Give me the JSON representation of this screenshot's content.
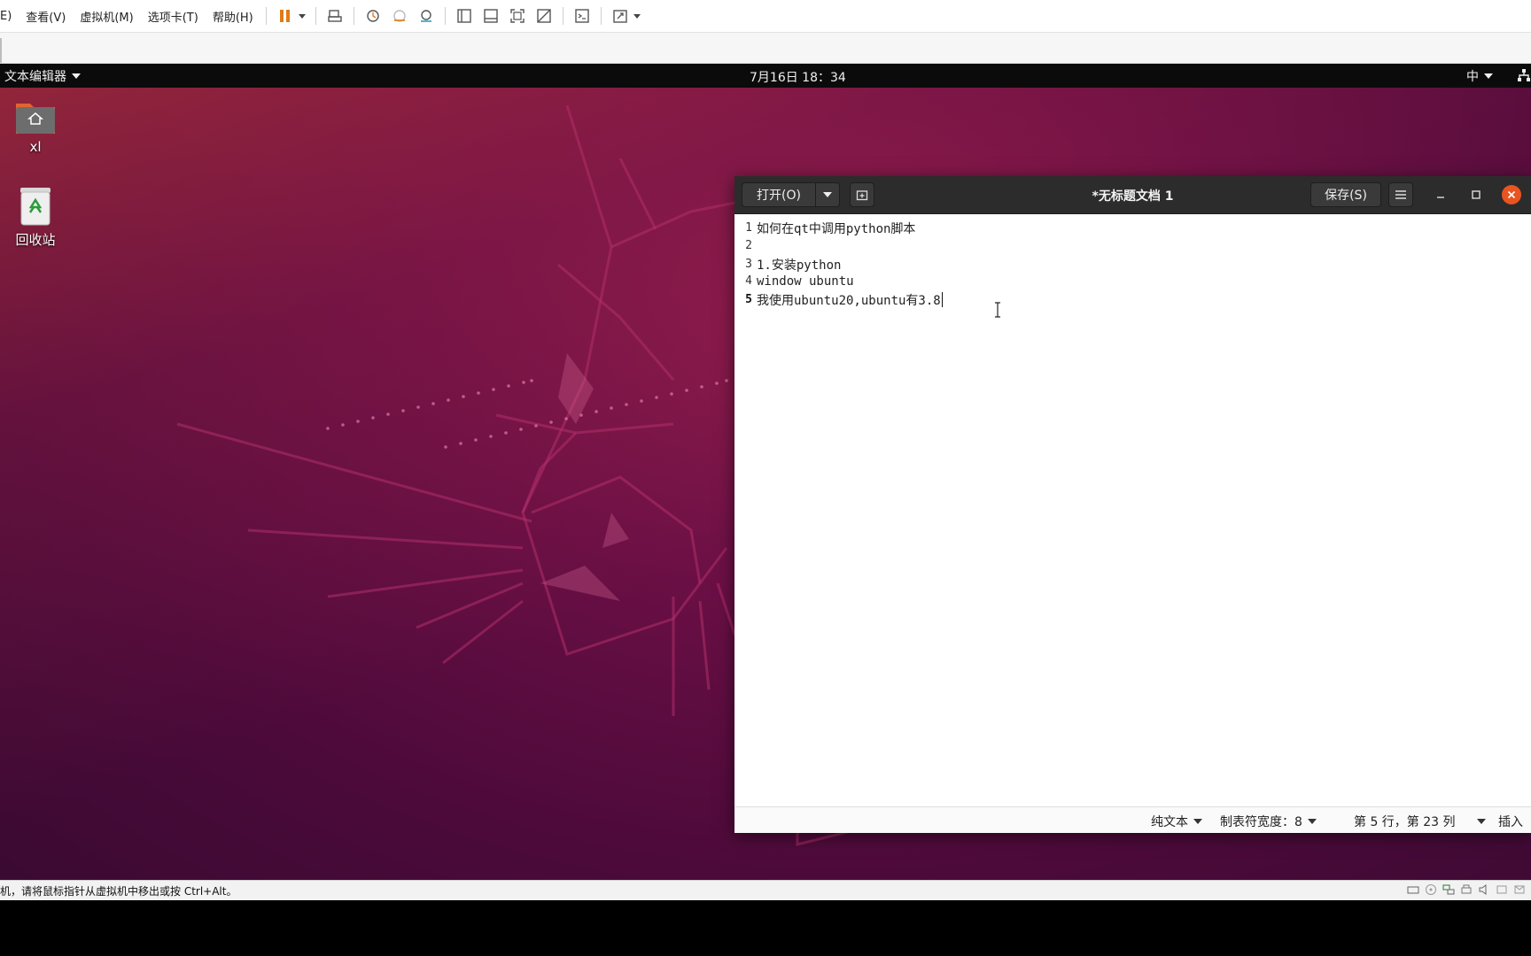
{
  "vmware": {
    "menu": [
      "E)",
      "查看(V)",
      "虚拟机(M)",
      "选项卡(T)",
      "帮助(H)"
    ],
    "status_message": "机，请将鼠标指针从虚拟机中移出或按 Ctrl+Alt。",
    "toolbar_icons": [
      "pause-icon",
      "send-keys-icon",
      "snapshot-icon",
      "revert-snapshot-icon",
      "snapshot-manager-icon",
      "console-view-icon",
      "thumbnail-view-icon",
      "fullscreen-icon",
      "unity-icon",
      "terminal-icon",
      "stretch-icon"
    ]
  },
  "gnome": {
    "app_menu": "文本编辑器",
    "clock": "7月16日  18：34",
    "input_method": "中"
  },
  "desktop": {
    "icons": [
      {
        "label": "xl",
        "icon": "home-folder-icon"
      },
      {
        "label": "回收站",
        "icon": "trash-icon"
      }
    ]
  },
  "gedit": {
    "open_label": "打开(O)",
    "title": "*无标题文档 1",
    "save_label": "保存(S)",
    "lines": [
      {
        "n": "1",
        "text": "如何在qt中调用python脚本"
      },
      {
        "n": "2",
        "text": ""
      },
      {
        "n": "3",
        "text": "1.安装python"
      },
      {
        "n": "4",
        "text": "window ubuntu"
      },
      {
        "n": "5",
        "text": "我使用ubuntu20,ubuntu有3.8"
      }
    ],
    "status": {
      "language": "纯文本",
      "tab_width": "制表符宽度：8",
      "position": "第 5 行，第 23 列",
      "mode": "插入"
    }
  },
  "colors": {
    "accent": "#e95420",
    "header": "#2c2c2c",
    "topbar": "#0b0b0b",
    "wallpaper": "#6a0f45"
  }
}
